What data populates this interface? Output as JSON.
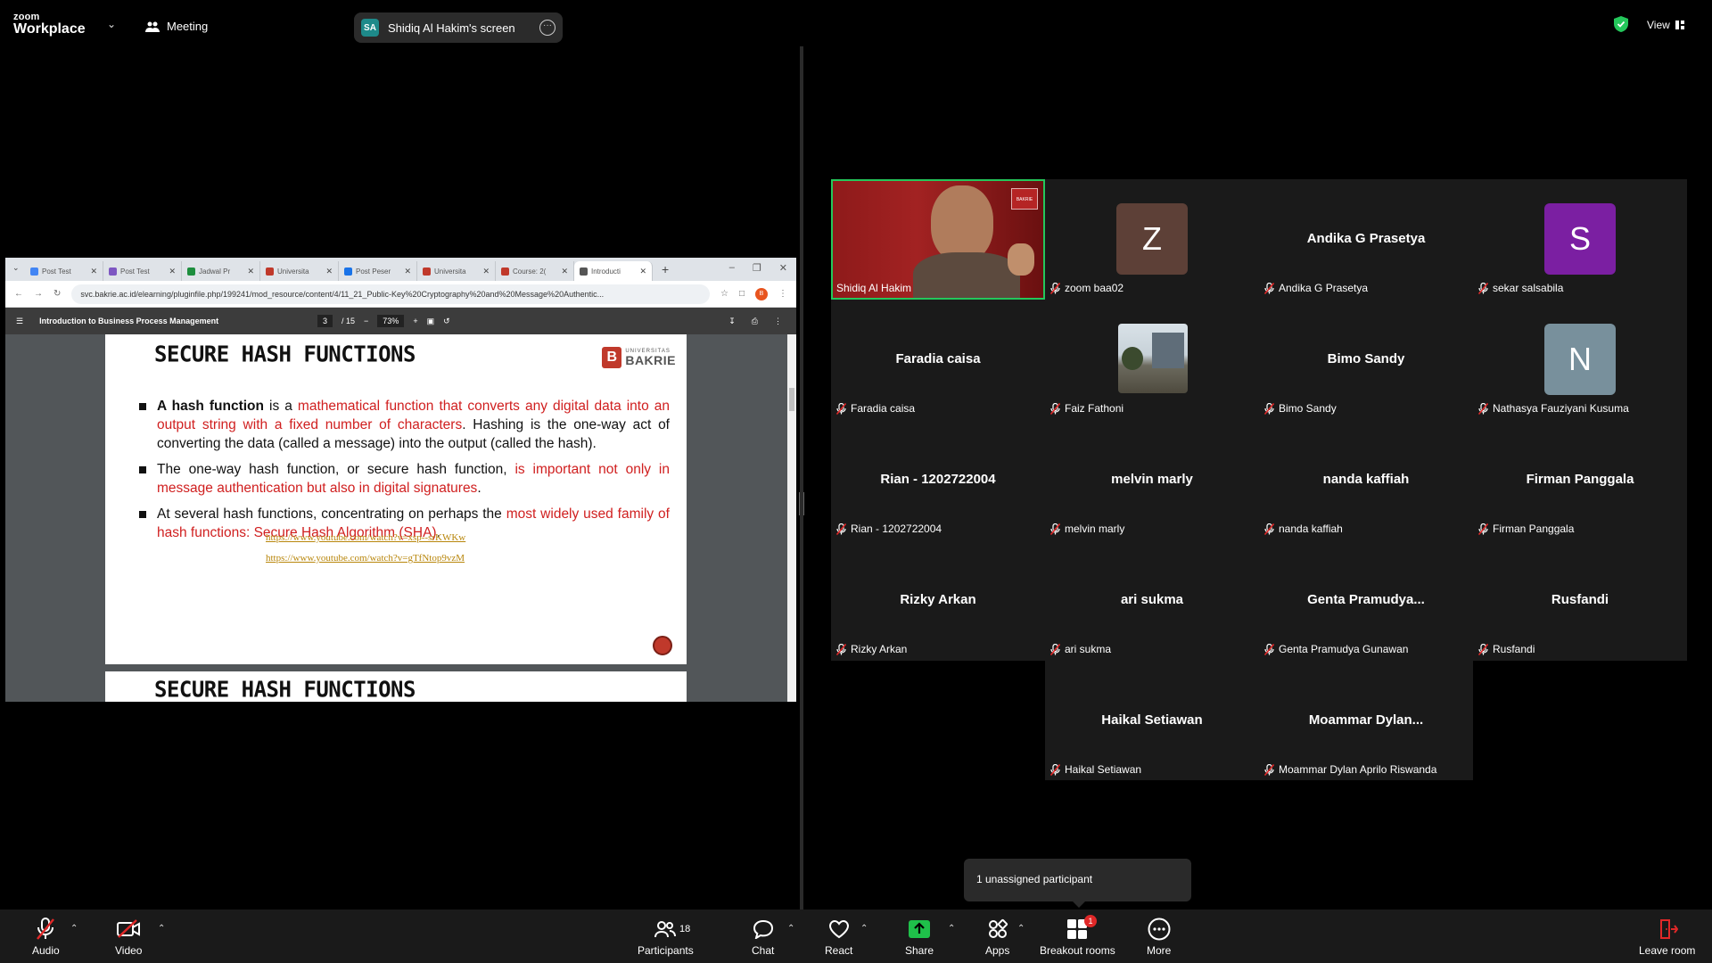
{
  "app": {
    "logo_line1": "zoom",
    "logo_line2": "Workplace",
    "meeting_label": "Meeting",
    "view_label": "View"
  },
  "share": {
    "initials": "SA",
    "label": "Shidiq Al Hakim's screen"
  },
  "browser": {
    "tabs": [
      "Post Test",
      "Post Test",
      "Jadwal Pr",
      "Universita",
      "Post Peser",
      "Universita",
      "Course: 2(",
      "Introducti"
    ],
    "tab_colors": [
      "#4285f4",
      "#7e57c2",
      "#1e8e3e",
      "#c0392b",
      "#1a73e8",
      "#c0392b",
      "#c0392b",
      "#555555"
    ],
    "url": "svc.bakrie.ac.id/elearning/pluginfile.php/199241/mod_resource/content/4/11_21_Public-Key%20Cryptography%20and%20Message%20Authentic...",
    "profile_initial": "B"
  },
  "pdf": {
    "doc_title": "Introduction to Business Process Management",
    "page_current": "3",
    "page_total": "/ 15",
    "zoom": "73%"
  },
  "slide": {
    "title": "SECURE HASH FUNCTIONS",
    "uni_small": "UNIVERSITAS",
    "uni_big": "BAKRIE",
    "uni_mark": "B",
    "b1_bold": "A hash function",
    "b1_t1": " is a ",
    "b1_red": "mathematical function that converts any digital data into an output string with a fixed number of characters",
    "b1_t2": ". Hashing is the one-way act of converting the data (called a message) into the output (called the hash).",
    "b2_t1": "The one-way hash function, or secure hash function, ",
    "b2_red": "is important not only in message authentication but also in digital signatures",
    "b2_t2": ".",
    "b3_t1": "At several hash functions, concentrating on perhaps the ",
    "b3_red": "most widely used family of hash functions: Secure Hash Algorithm (SHA)",
    "b3_t2": ".",
    "link1": "https://www.youtube.com/watch?v=xsp--srKWKw",
    "link2": "https://www.youtube.com/watch?v=gTfNtop9vzM",
    "next_title": "SECURE HASH FUNCTIONS"
  },
  "gallery": {
    "tiles": [
      {
        "label": "Shidiq Al Hakim",
        "name": "",
        "type": "video",
        "muted": false
      },
      {
        "label": "zoom baa02",
        "name": "",
        "type": "avatar",
        "initial": "Z",
        "color": "#5d4037",
        "muted": true
      },
      {
        "label": "Andika G Prasetya",
        "name": "Andika G Prasetya",
        "type": "name",
        "muted": true
      },
      {
        "label": "sekar salsabila",
        "name": "",
        "type": "avatar",
        "initial": "S",
        "color": "#7b1fa2",
        "muted": true
      },
      {
        "label": "Faradia caisa",
        "name": "Faradia caisa",
        "type": "name",
        "muted": true
      },
      {
        "label": "Faiz Fathoni",
        "name": "",
        "type": "photo",
        "muted": true
      },
      {
        "label": "Bimo Sandy",
        "name": "Bimo Sandy",
        "type": "name",
        "muted": true
      },
      {
        "label": "Nathasya Fauziyani Kusuma",
        "name": "",
        "type": "avatar",
        "initial": "N",
        "color": "#78909c",
        "muted": true
      },
      {
        "label": "Rian - 1202722004",
        "name": "Rian - 1202722004",
        "type": "name",
        "muted": true
      },
      {
        "label": "melvin marly",
        "name": "melvin marly",
        "type": "name",
        "muted": true
      },
      {
        "label": "nanda kaffiah",
        "name": "nanda kaffiah",
        "type": "name",
        "muted": true
      },
      {
        "label": "Firman Panggala",
        "name": "Firman Panggala",
        "type": "name",
        "muted": true
      },
      {
        "label": "Rizky Arkan",
        "name": "Rizky Arkan",
        "type": "name",
        "muted": true
      },
      {
        "label": "ari sukma",
        "name": "ari sukma",
        "type": "name",
        "muted": true
      },
      {
        "label": "Genta Pramudya Gunawan",
        "name": "Genta  Pramudya...",
        "type": "name",
        "muted": true
      },
      {
        "label": "Rusfandi",
        "name": "Rusfandi",
        "type": "name",
        "muted": true
      },
      {
        "label": "Haikal Setiawan",
        "name": "Haikal Setiawan",
        "type": "name",
        "muted": true
      },
      {
        "label": "Moammar Dylan Aprilo Riswanda",
        "name": "Moammar  Dylan...",
        "type": "name",
        "muted": true
      }
    ]
  },
  "popup": {
    "unassigned": "1 unassigned participant"
  },
  "toolbar": {
    "audio": "Audio",
    "video": "Video",
    "participants": "Participants",
    "participants_count": "18",
    "chat": "Chat",
    "react": "React",
    "share": "Share",
    "apps": "Apps",
    "breakout": "Breakout rooms",
    "breakout_badge": "1",
    "more": "More",
    "leave": "Leave room"
  },
  "colors": {
    "accent_green": "#24c75b",
    "share_green": "#1fc14a",
    "danger": "#e02828"
  }
}
